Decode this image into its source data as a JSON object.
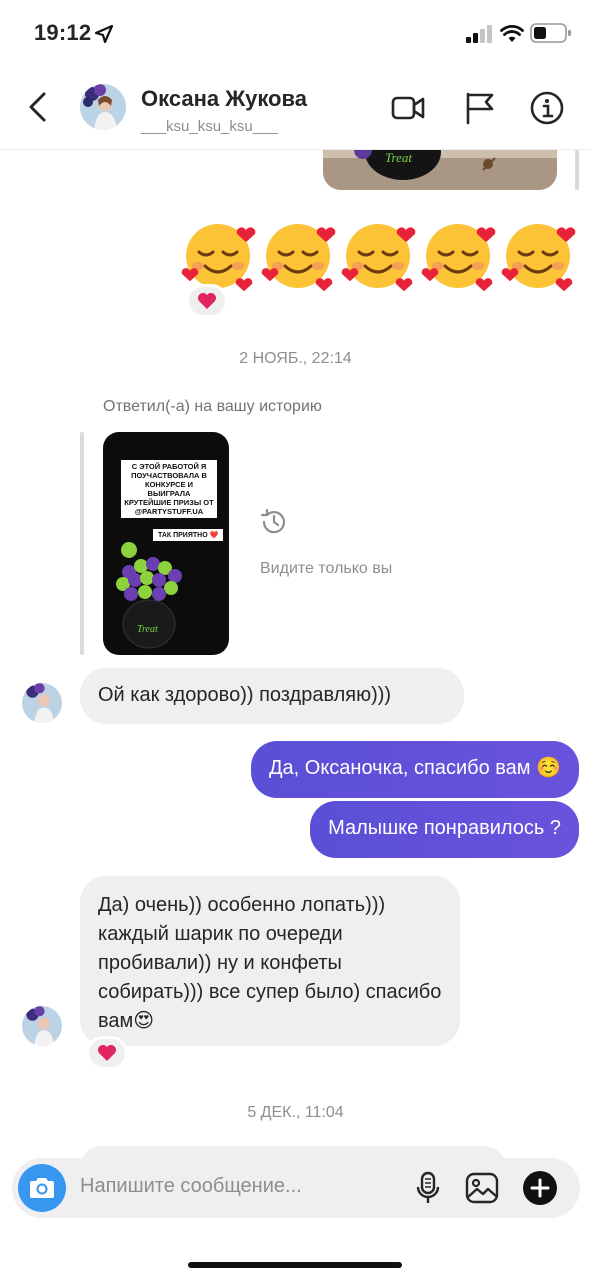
{
  "status_bar": {
    "time": "19:12"
  },
  "header": {
    "name": "Оксана Жукова",
    "username": "___ksu_ksu_ksu___"
  },
  "messages": {
    "emoji_row": "☺️☺️☺️☺️☺️",
    "reaction": "❤️",
    "timestamp_1": "2 НОЯБ., 22:14",
    "replied_note": "Ответил(-а) на вашу историю",
    "story": {
      "text": "С ЭТОЙ РАБОТОЙ Я ПОУЧАСТВОВАЛА В КОНКУРСЕ И ВЫИГРАЛА КРУТЕЙШИЕ ПРИЗЫ ОТ @PARTYSTUFF.UA",
      "tag": "ТАК ПРИЯТНО ❤️",
      "balloon_label": "Treat"
    },
    "only_you": "Видите только вы",
    "in_1": "Ой как здорово)) поздравляю)))",
    "out_1": "Да, Оксаночка, спасибо вам ☺️",
    "out_2": "Малышке понравилось ?",
    "in_2": "Да) очень)) особенно лопать))) каждый шарик по очереди пробивали)) ну и конфеты собирать))) все супер было) спасибо вам😍",
    "timestamp_2": "5 ДЕК., 11:04"
  },
  "composer": {
    "placeholder": "Напишите сообщение..."
  },
  "colors": {
    "outgoing_bubble": "#5b51d8",
    "incoming_bubble": "#efefef",
    "camera_button": "#3797f0"
  },
  "icons": [
    "back-icon",
    "video-call-icon",
    "flag-icon",
    "info-icon",
    "camera-icon",
    "microphone-icon",
    "gallery-icon",
    "add-icon",
    "history-icon"
  ]
}
